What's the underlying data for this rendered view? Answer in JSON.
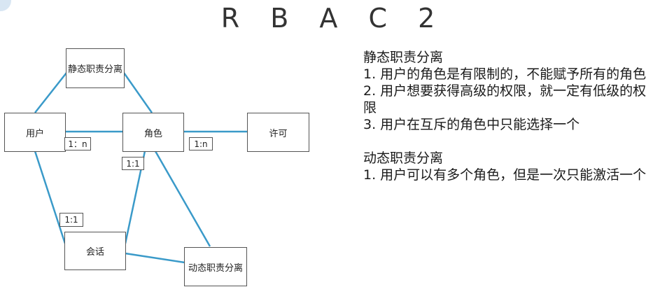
{
  "title": "R B A C 2",
  "nodes": {
    "static_sod": "静态职责分离",
    "user": "用户",
    "role": "角色",
    "permission": "许可",
    "session": "会话",
    "dynamic_sod": "动态职责分离"
  },
  "labels": {
    "user_role": "1：n",
    "role_perm": "1:n",
    "role_session": "1:1",
    "user_session": "1:1"
  },
  "notes": {
    "static_heading": "静态职责分离",
    "static_items": [
      "1. 用户的角色是有限制的，不能赋予所有的角色",
      "2. 用户想要获得高级的权限，就一定有低级的权限",
      "3. 用户在互斥的角色中只能选择一个"
    ],
    "dynamic_heading": "动态职责分离",
    "dynamic_items": [
      "1. 用户可以有多个角色，但是一次只能激活一个"
    ]
  },
  "colors": {
    "connector": "#3a9ac9",
    "border": "#555555"
  }
}
